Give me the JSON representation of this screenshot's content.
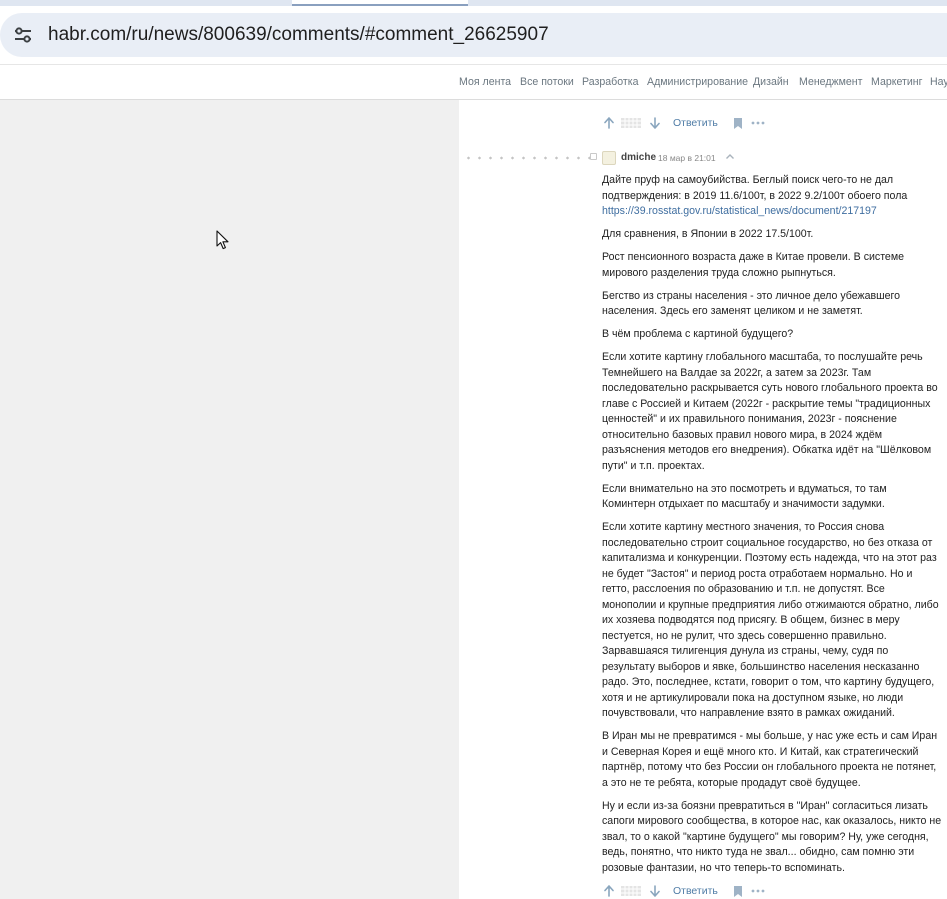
{
  "browser": {
    "url": "habr.com/ru/news/800639/comments/#comment_26625907",
    "site_info_icon": "tune-icon"
  },
  "nav": {
    "items": [
      "Моя лента",
      "Все потоки",
      "Разработка",
      "Администрирование",
      "Дизайн",
      "Менеджмент",
      "Маркетинг",
      "Научпоп"
    ]
  },
  "actions": {
    "reply_label": "Ответить",
    "icons": [
      "arrow-up-icon",
      "arrow-down-icon",
      "bookmark-icon",
      "more-icon"
    ]
  },
  "comment": {
    "author": "dmiche",
    "datetime": "18 мар в 21:01",
    "paragraphs": [
      {
        "text": "Дайте пруф на самоубийства. Беглый поиск чего-то не дал подтверждения: в 2019 11.6/100т, в 2022 9.2/100т обоего пола",
        "link": "https://39.rosstat.gov.ru/statistical_news/document/217197"
      },
      {
        "text": "Для сравнения, в Японии в 2022 17.5/100т."
      },
      {
        "text": "Рост пенсионного возраста даже в Китае провели. В системе мирового разделения труда сложно рыпнуться."
      },
      {
        "text": "Бегство из страны населения - это личное дело убежавшего населения. Здесь его заменят целиком и не заметят."
      },
      {
        "text": "В чём проблема с картиной будущего?"
      },
      {
        "text": "Если хотите картину глобального масштаба, то послушайте речь Темнейшего на Валдае за 2022г, а затем за 2023г. Там последовательно раскрывается суть нового глобального проекта во главе с Россией и Китаем (2022г - раскрытие темы \"традиционных ценностей\" и их правильного понимания, 2023г - пояснение относительно базовых правил нового мира, в 2024 ждём разъяснения методов его внедрения). Обкатка идёт на \"Шёлковом пути\" и т.п. проектах."
      },
      {
        "text": "Если внимательно на это посмотреть и вдуматься, то там Коминтерн отдыхает по масштабу и значимости задумки."
      },
      {
        "text": "Если хотите картину местного значения, то Россия снова последовательно строит социальное государство, но без отказа от капитализма и конкуренции. Поэтому есть надежда, что на этот раз не будет \"Застоя\" и период роста отработаем нормально. Но и гетто, расслоения по образованию и т.п. не допустят. Все монополии и крупные предприятия либо отжимаются обратно, либо их хозяева подводятся под присягу. В общем, бизнес в меру пестуется, но не рулит, что здесь совершенно правильно. Зарвавшаяся тилигенция дунула из страны, чему, судя по результату выборов и явке, большинство населения несказанно радо. Это, последнее, кстати, говорит о том, что картину будущего, хотя и не артикулировали пока на доступном языке, но люди почувствовали, что направление взято в рамках ожиданий."
      },
      {
        "text": "В Иран мы не превратимся - мы больше, у нас уже есть и сам Иран и Северная Корея и ещё много кто. И Китай, как стратегический партнёр, потому что без России он глобального проекта не потянет, а это не те ребята, которые продадут своё будущее."
      },
      {
        "text": "Ну и если из-за боязни превратиться в \"Иран\" согласиться лизать сапоги мирового сообщества, в которое нас, как оказалось, никто не звал, то о какой \"картине будущего\" мы говорим? Ну, уже сегодня, ведь, понятно, что никто туда не звал... обидно, сам помню эти розовые фантазии, но что теперь-то вспоминать."
      }
    ]
  }
}
